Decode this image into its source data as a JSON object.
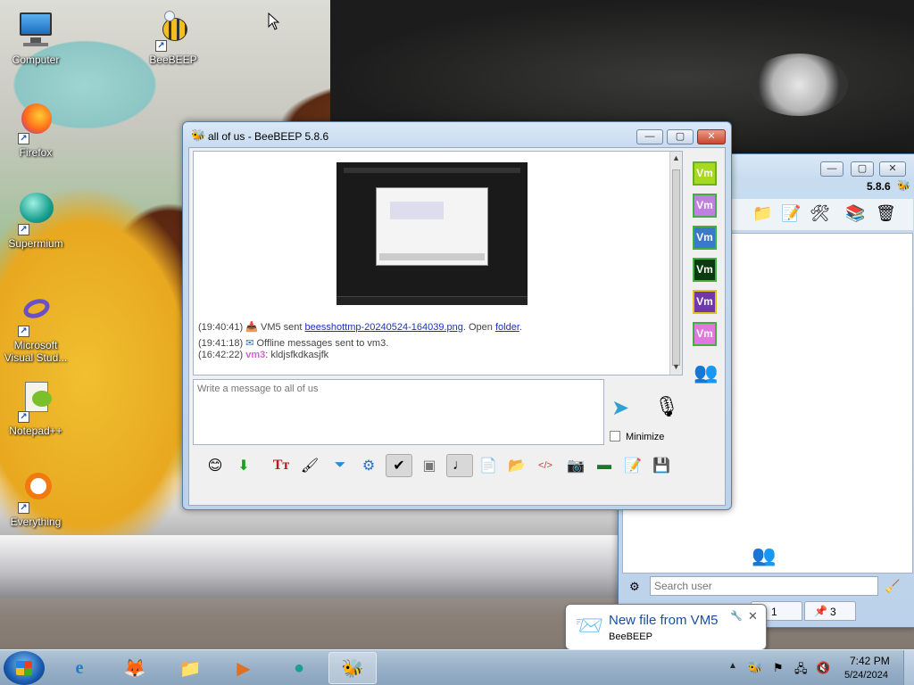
{
  "desktop": {
    "icons": [
      {
        "label": "Computer"
      },
      {
        "label": "BeeBEEP"
      },
      {
        "label": "Firefox"
      },
      {
        "label": "Supermium"
      },
      {
        "label": "Microsoft Visual Stud..."
      },
      {
        "label": "Notepad++"
      },
      {
        "label": "Everything"
      }
    ]
  },
  "chat_window": {
    "title": "all of us - BeeBEEP 5.8.6",
    "messages": [
      {
        "time": "(19:40:41)",
        "sender": "VM5 sent ",
        "file": "beesshottmp-20240524-164039.png",
        "mid": ". Open ",
        "folder": "folder",
        "end": "."
      },
      {
        "time": "(19:41:18)",
        "text": "Offline messages sent to vm3."
      },
      {
        "time": "(16:42:22)",
        "user": "vm3",
        "text": ": kldjsfkdkasjfk"
      }
    ],
    "users": [
      {
        "label": "Vm",
        "bg": "#a8d820",
        "border": "#6ab020"
      },
      {
        "label": "Vm",
        "bg": "#c080e0",
        "border": "#40b040"
      },
      {
        "label": "Vm",
        "bg": "#3a78c8",
        "border": "#40b040"
      },
      {
        "label": "Vm",
        "bg": "#0c3a10",
        "border": "#40b040"
      },
      {
        "label": "Vm",
        "bg": "#7038a8",
        "border": "#e0c020"
      },
      {
        "label": "Vm",
        "bg": "#e078e0",
        "border": "#40b040"
      }
    ],
    "input_placeholder": "Write a message to all of us",
    "minimize_label": "Minimize"
  },
  "main_window": {
    "version": "5.8.6",
    "search_placeholder": "Search user",
    "tab1_count": "1",
    "tab2_count": "3"
  },
  "notification": {
    "title": "New file from VM5",
    "subtitle": "BeeBEEP"
  },
  "taskbar": {
    "time": "7:42 PM",
    "date": "5/24/2024"
  }
}
